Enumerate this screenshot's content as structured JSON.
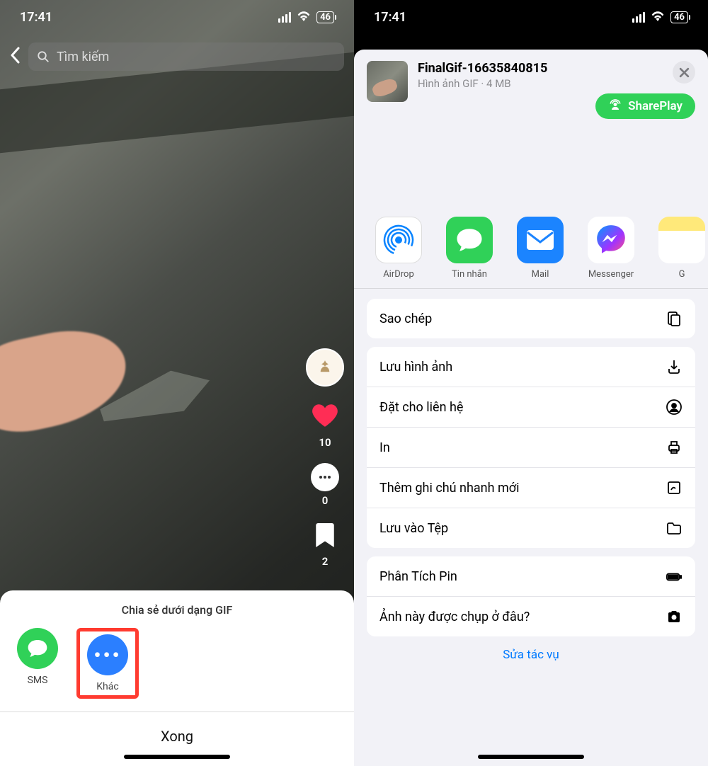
{
  "status": {
    "time": "17:41",
    "battery": "46"
  },
  "left": {
    "search_placeholder": "Tìm kiếm",
    "like_count": "10",
    "comment_count": "0",
    "bookmark_count": "2",
    "share_title": "Chia sẻ dưới dạng GIF",
    "options": {
      "sms": "SMS",
      "more": "Khác"
    },
    "done": "Xong"
  },
  "right": {
    "file_name": "FinalGif-16635840815",
    "file_meta": "Hình ảnh GIF · 4 MB",
    "shareplay": "SharePlay",
    "apps": {
      "airdrop": "AirDrop",
      "messages": "Tin nhắn",
      "mail": "Mail",
      "messenger": "Messenger",
      "extra": "G"
    },
    "actions": {
      "copy": "Sao chép",
      "save_image": "Lưu hình ảnh",
      "assign_contact": "Đặt cho liên hệ",
      "print": "In",
      "quick_note": "Thêm ghi chú nhanh mới",
      "save_files": "Lưu vào Tệp",
      "battery_analyze": "Phân Tích Pin",
      "where_taken": "Ảnh này được chụp ở đâu?"
    },
    "edit_actions": "Sửa tác vụ"
  }
}
